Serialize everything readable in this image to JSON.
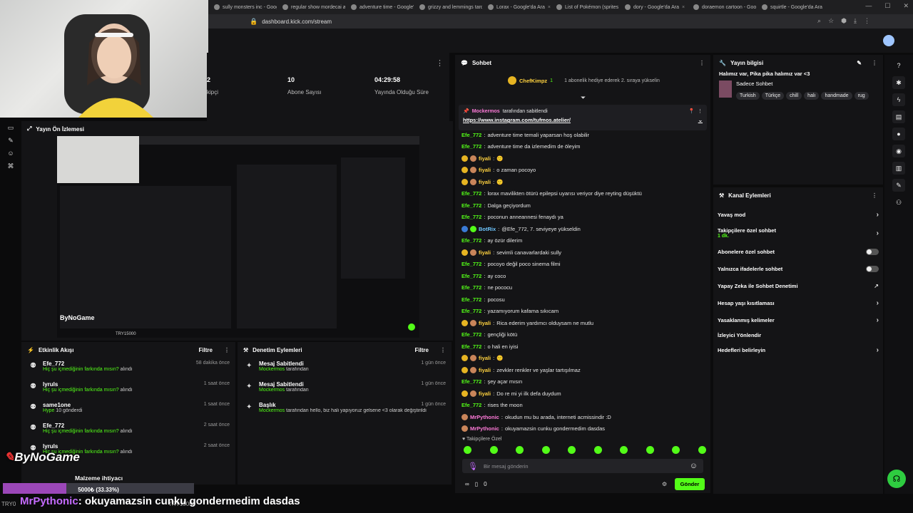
{
  "browser": {
    "tabs": [
      "sully monsters inc - Goog",
      "regular show mordecai and",
      "adventure time - Google'da",
      "grizzy and lemmings tarde",
      "Lorax - Google'da Ara",
      "List of Pokémon (sprites ga",
      "dory - Google'da Ara",
      "doraemon cartoon - Google",
      "squirtle - Google'da Ara"
    ],
    "url": "dashboard.kick.com/stream"
  },
  "stats": {
    "followers_value": "2",
    "followers_label": "kipçi",
    "subs_value": "10",
    "subs_label": "Abone Sayısı",
    "uptime_value": "04:29:58",
    "uptime_label": "Yayında Olduğu Süre"
  },
  "preview": {
    "title": "Yayın Ön İzlemesi",
    "logo_text": "ByNoGame",
    "goal": "TRY15000"
  },
  "activity": {
    "title": "Etkinlik Akışı",
    "filter": "Filtre",
    "items": [
      {
        "name": "Efe_772",
        "time": "58 dakika önce",
        "highlight": "Hiç şu içmediğinin farkında mısın?",
        "suffix": "alındı"
      },
      {
        "name": "lyruls",
        "time": "1 saat önce",
        "highlight": "Hiç şu içmediğinin farkında mısın?",
        "suffix": "alındı"
      },
      {
        "name": "same1one",
        "time": "1 saat önce",
        "highlight": "Hype",
        "suffix": "10 gönderdi"
      },
      {
        "name": "Efe_772",
        "time": "2 saat önce",
        "highlight": "Hiç şu içmediğinin farkında mısın?",
        "suffix": "alındı"
      },
      {
        "name": "lyruls",
        "time": "2 saat önce",
        "highlight": "Hiç şu içmediğinin farkında mısın?",
        "suffix": "alındı"
      }
    ]
  },
  "moderation": {
    "title": "Denetim Eylemleri",
    "filter": "Filtre",
    "items": [
      {
        "title": "Mesaj Sabitlendi",
        "time": "1 gün önce",
        "actor": "Mockermos",
        "desc": "tarafından"
      },
      {
        "title": "Mesaj Sabitlendi",
        "time": "1 gün önce",
        "actor": "Mockermos",
        "desc": "tarafından"
      },
      {
        "title": "Başlık",
        "time": "1 gün önce",
        "actor": "Mockermos",
        "desc": "tarafından hello, biz hali yapıyoruz gelsene <3 olarak değiştirildi"
      }
    ]
  },
  "chat": {
    "title": "Sohbet",
    "gifter": "ChefKimpz",
    "gifter_count": "1",
    "gift_text": "1 abonelik hediye ederek 2. sıraya yükselin",
    "pinned_by": "Mockermos",
    "pinned_suffix": "tarafından sabitlendi",
    "pinned_link": "https://www.instagram.com/tufmos.atelier/",
    "messages": [
      {
        "user": "Efe_772",
        "cls": "u-green",
        "text": "adventure time temali yaparsan hoş olabilir"
      },
      {
        "user": "Efe_772",
        "cls": "u-green",
        "text": "adventure time da izlemedim de öleyim"
      },
      {
        "user": "fiyali",
        "cls": "u-yellow",
        "text": "🙂"
      },
      {
        "user": "fiyali",
        "cls": "u-yellow",
        "text": "o zaman pocoyo"
      },
      {
        "user": "fiyali",
        "cls": "u-yellow",
        "text": "🙂"
      },
      {
        "user": "Efe_772",
        "cls": "u-green",
        "text": "lorax mavilikten ötürü epilepsi uyarısı veriyor diye reyting düşüktü"
      },
      {
        "user": "Efe_772",
        "cls": "u-green",
        "text": "Dalga geçiyordum"
      },
      {
        "user": "Efe_772",
        "cls": "u-green",
        "text": "poconun anneannesi fenaydı ya"
      },
      {
        "user": "BotRix",
        "cls": "u-blue",
        "text": "@Efe_772, 7. seviyeye yükseldin"
      },
      {
        "user": "Efe_772",
        "cls": "u-green",
        "text": "ay özür dilerim"
      },
      {
        "user": "fiyali",
        "cls": "u-yellow",
        "text": "sevimli canavarlardaki sully"
      },
      {
        "user": "Efe_772",
        "cls": "u-green",
        "text": "pocoyo değil poco sinema filmi"
      },
      {
        "user": "Efe_772",
        "cls": "u-green",
        "text": "ay coco"
      },
      {
        "user": "Efe_772",
        "cls": "u-green",
        "text": "ne pococu"
      },
      {
        "user": "Efe_772",
        "cls": "u-green",
        "text": "pocosu"
      },
      {
        "user": "Efe_772",
        "cls": "u-green",
        "text": "yazamıyorum kafama sıkıcam"
      },
      {
        "user": "fiyali",
        "cls": "u-yellow",
        "text": "Rica ederim yardımcı olduysam ne mutlu"
      },
      {
        "user": "Efe_772",
        "cls": "u-green",
        "text": "gençliği kötü"
      },
      {
        "user": "Efe_772",
        "cls": "u-green",
        "text": "o hali en iyisi"
      },
      {
        "user": "fiyali",
        "cls": "u-yellow",
        "text": "🙂"
      },
      {
        "user": "fiyali",
        "cls": "u-yellow",
        "text": "zevkler renkler ve yaşlar tartışılmaz"
      },
      {
        "user": "Efe_772",
        "cls": "u-green",
        "text": "şey açar mısın"
      },
      {
        "user": "fiyali",
        "cls": "u-yellow",
        "text": "Do re mi yi ilk defa duydum"
      },
      {
        "user": "Efe_772",
        "cls": "u-green",
        "text": "rises the moon"
      },
      {
        "user": "MrPythonic",
        "cls": "u-pink",
        "text": "okudun mu bu arada, interneti acmissindir :D"
      },
      {
        "user": "MrPythonic",
        "cls": "u-pink",
        "text": "okuyamazsin cunku gondermedim dasdas"
      }
    ],
    "followers_only": "Takipçilere Özel",
    "input_placeholder": "Bir mesaj gönderin",
    "points": "0",
    "send_label": "Gönder"
  },
  "streaminfo": {
    "title": "Yayın bilgisi",
    "stream_title": "Halımız var, Pika pika halımız var <3",
    "category": "Sadece Sohbet",
    "tags": [
      "Turkish",
      "Türkçe",
      "chill",
      "halı",
      "handmade",
      "rug"
    ]
  },
  "channelactions": {
    "title": "Kanal Eylemleri",
    "slow_mode": "Yavaş mod",
    "followers_chat": "Takipçilere özel sohbet",
    "followers_chat_sub": "1 dk.",
    "subs_chat": "Abonelere özel sohbet",
    "emotes_chat": "Yalnızca ifadelerle sohbet",
    "ai_moderation": "Yapay Zeka ile Sohbet Denetimi",
    "account_age": "Hesap yaşı kısıtlaması",
    "banned_words": "Yasaklanmış kelimeler",
    "host": "İzleyici Yönlendir",
    "goals": "Hedefleri belirleyin"
  },
  "overlay": {
    "logo": "ByNoGame",
    "goal_label": "Malzeme ihtiyacı",
    "goal_progress_text": "5000₺ (33.33%)",
    "goal_progress": 0.3333,
    "try_left": "TRY0",
    "try_right": "TRY15000",
    "caption_user": "MrPythonic",
    "caption_text": ": okuyamazsin cunku gondermedim dasdas"
  }
}
